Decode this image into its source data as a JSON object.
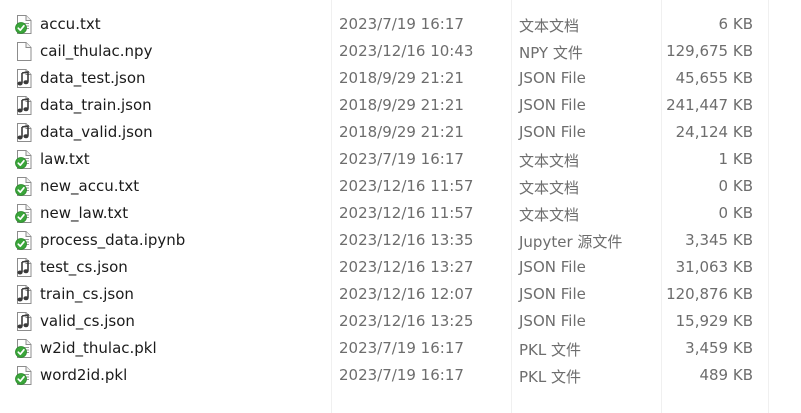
{
  "files": [
    {
      "name": "accu.txt",
      "modified": "2023/7/19 16:17",
      "type": "文本文档",
      "size": "6 KB",
      "icon": "text-file-icon"
    },
    {
      "name": "cail_thulac.npy",
      "modified": "2023/12/16 10:43",
      "type": "NPY 文件",
      "size": "129,675 KB",
      "icon": "blank-file-icon"
    },
    {
      "name": "data_test.json",
      "modified": "2018/9/29 21:21",
      "type": "JSON File",
      "size": "45,655 KB",
      "icon": "json-file-icon"
    },
    {
      "name": "data_train.json",
      "modified": "2018/9/29 21:21",
      "type": "JSON File",
      "size": "241,447 KB",
      "icon": "json-file-icon"
    },
    {
      "name": "data_valid.json",
      "modified": "2018/9/29 21:21",
      "type": "JSON File",
      "size": "24,124 KB",
      "icon": "json-file-icon"
    },
    {
      "name": "law.txt",
      "modified": "2023/7/19 16:17",
      "type": "文本文档",
      "size": "1 KB",
      "icon": "text-file-icon"
    },
    {
      "name": "new_accu.txt",
      "modified": "2023/12/16 11:57",
      "type": "文本文档",
      "size": "0 KB",
      "icon": "text-file-icon"
    },
    {
      "name": "new_law.txt",
      "modified": "2023/12/16 11:57",
      "type": "文本文档",
      "size": "0 KB",
      "icon": "text-file-icon"
    },
    {
      "name": "process_data.ipynb",
      "modified": "2023/12/16 13:35",
      "type": "Jupyter 源文件",
      "size": "3,345 KB",
      "icon": "notebook-file-icon"
    },
    {
      "name": "test_cs.json",
      "modified": "2023/12/16 13:27",
      "type": "JSON File",
      "size": "31,063 KB",
      "icon": "json-file-icon"
    },
    {
      "name": "train_cs.json",
      "modified": "2023/12/16 12:07",
      "type": "JSON File",
      "size": "120,876 KB",
      "icon": "json-file-icon"
    },
    {
      "name": "valid_cs.json",
      "modified": "2023/12/16 13:25",
      "type": "JSON File",
      "size": "15,929 KB",
      "icon": "json-file-icon"
    },
    {
      "name": "w2id_thulac.pkl",
      "modified": "2023/7/19 16:17",
      "type": "PKL 文件",
      "size": "3,459 KB",
      "icon": "pkl-file-icon"
    },
    {
      "name": "word2id.pkl",
      "modified": "2023/7/19 16:17",
      "type": "PKL 文件",
      "size": "489 KB",
      "icon": "pkl-file-icon"
    }
  ],
  "colors": {
    "name_text": "#1b1b1b",
    "meta_text": "#6d6d6d",
    "check_green": "#3aa53a",
    "separator": "#f0f0f0"
  }
}
